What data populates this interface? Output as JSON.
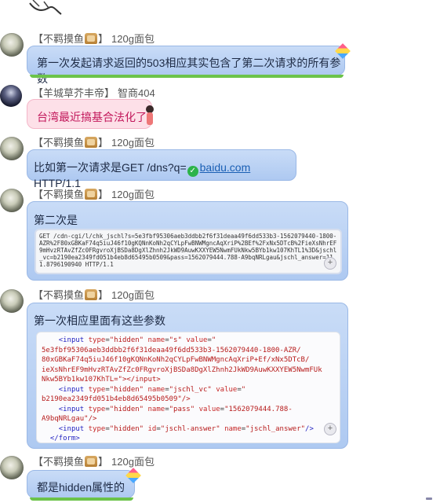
{
  "messages": [
    {
      "sender": "【不羁摸鱼",
      "suffix": "】",
      "size": "120g面包",
      "text": "第一次发起请求返回的503相应其实包含了第二次请求的所有参数"
    },
    {
      "sender": "【羊城草芥丰帝】",
      "size": "智商404",
      "text": "台湾最近搞基合法化了"
    },
    {
      "sender": "【不羁摸鱼",
      "suffix": "】",
      "size": "120g面包",
      "text_prefix": "比如第一次请求是GET /dns?q=",
      "link": "baidu.com",
      "text_suffix": " HTTP/1.1"
    },
    {
      "sender": "【不羁摸鱼",
      "suffix": "】",
      "size": "120g面包",
      "text": "第二次是",
      "code": "GET /cdn-cgi/l/chk_jschl?s=5e3fbf95306aeb3ddbb2f6f31deaa49f6dd533b3-1562079440-1800-AZR%2F80xGBKaF74q5iuJ46f10gKQNnKoNh2qCYLpFwBNWMgncAqXriP%2BEf%2FxNx5DTcB%2FieXsNhrEF9mHvzRTAvZfZc0FRgvroXjBSDa8DgXlZhnh2JkWD9AuwKXXYEW5NwmFUkNkw5BYb1kw107KhTL1%3D&jschl_vc=b2190ea2349fd051b4eb8d65495b0509&pass=1562079444.788-A9bqNRLgau&jschl_answer=111.8796190940 HTTP/1.1"
    },
    {
      "sender": "【不羁摸鱼",
      "suffix": "】",
      "size": "120g面包",
      "text": "第一次相应里面有这些参数",
      "code_lines": [
        {
          "indent": "    ",
          "tag": "<input",
          "parts": [
            [
              "type",
              "\"hidden\""
            ],
            [
              "name",
              "\"s\""
            ],
            [
              "value",
              "\""
            ]
          ],
          "close": ""
        },
        {
          "indent": "",
          "raw": "5e3fbf95306aeb3ddbb2f6f31deaa49f6dd533b3-1562079440-1800-AZR/"
        },
        {
          "indent": "",
          "raw": "80xGBKaF74q5iuJ46f10gKQNnKoNh2qCYLpFwBNWMgncAqXriP+Ef/xNx5DTcB/"
        },
        {
          "indent": "",
          "raw": "ieXsNhrEF9mHvzRTAvZfZc0FRgvroXjBSDa8DgXlZhnh2JkWD9AuwKXXYEW5NwmFUk"
        },
        {
          "indent": "",
          "raw": "Nkw5BYb1kw107KhTL=\"></input>"
        },
        {
          "indent": "    ",
          "tag": "<input",
          "parts": [
            [
              "type",
              "\"hidden\""
            ],
            [
              "name",
              "\"jschl_vc\""
            ],
            [
              "value",
              "\""
            ]
          ],
          "close": ""
        },
        {
          "indent": "",
          "raw": "b2190ea2349fd051b4eb8d65495b0509\"/>"
        },
        {
          "indent": "    ",
          "tag": "<input",
          "parts": [
            [
              "type",
              "\"hidden\""
            ],
            [
              "name",
              "\"pass\""
            ],
            [
              "value",
              "\"1562079444.788-"
            ]
          ],
          "close": ""
        },
        {
          "indent": "",
          "raw": "A9bqNRLgau\"/>"
        },
        {
          "indent": "    ",
          "tag": "<input",
          "parts": [
            [
              "type",
              "\"hidden\""
            ],
            [
              "id",
              "\"jschl-answer\""
            ],
            [
              "name",
              "\"jschl_answer\""
            ]
          ],
          "close": "/>"
        },
        {
          "indent": "  ",
          "raw": "</form>"
        }
      ]
    },
    {
      "sender": "【不羁摸鱼",
      "suffix": "】",
      "size": "120g面包",
      "text": "都是hidden属性的"
    }
  ]
}
